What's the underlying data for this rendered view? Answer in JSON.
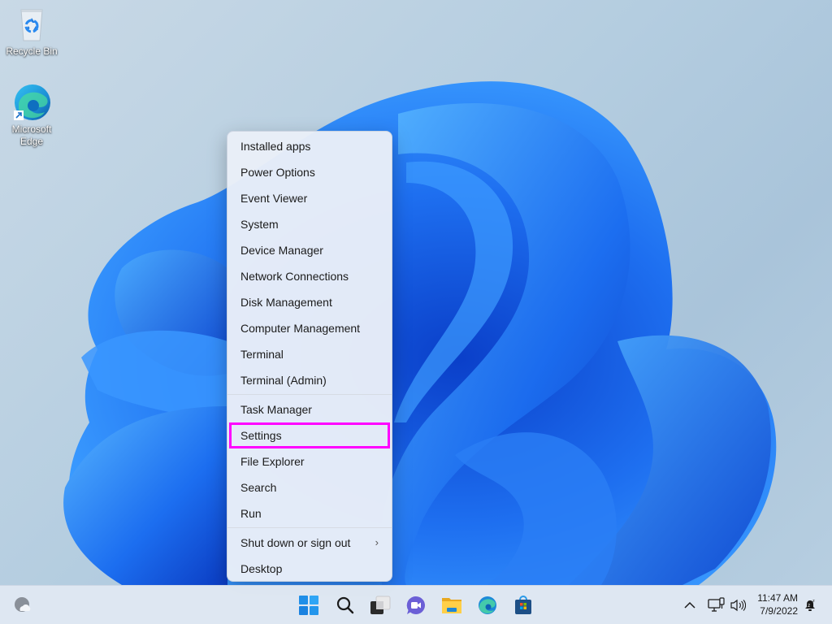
{
  "desktop": {
    "icons": [
      {
        "label": "Recycle Bin",
        "icon": "recycle-bin-icon"
      },
      {
        "label": "Microsoft Edge",
        "label_line1": "Microsoft",
        "label_line2": "Edge",
        "icon": "edge-icon",
        "shortcut": true
      }
    ]
  },
  "context_menu": {
    "groups": [
      [
        "Installed apps",
        "Power Options",
        "Event Viewer",
        "System",
        "Device Manager",
        "Network Connections",
        "Disk Management",
        "Computer Management",
        "Terminal",
        "Terminal (Admin)"
      ],
      [
        "Task Manager",
        "Settings",
        "File Explorer",
        "Search",
        "Run"
      ],
      [
        "Shut down or sign out",
        "Desktop"
      ]
    ],
    "items": {
      "installed_apps": "Installed apps",
      "power_options": "Power Options",
      "event_viewer": "Event Viewer",
      "system": "System",
      "device_manager": "Device Manager",
      "network_connections": "Network Connections",
      "disk_management": "Disk Management",
      "computer_management": "Computer Management",
      "terminal": "Terminal",
      "terminal_admin": "Terminal (Admin)",
      "task_manager": "Task Manager",
      "settings": "Settings",
      "file_explorer": "File Explorer",
      "search": "Search",
      "run": "Run",
      "shut_down": "Shut down or sign out",
      "desktop": "Desktop"
    },
    "highlighted_item": "Settings",
    "submenu_chevron": "›",
    "highlight_color": "#ff00ff"
  },
  "taskbar": {
    "widgets_icon": "weather-cloudy-moon-icon",
    "pinned": [
      {
        "name": "start",
        "icon": "windows-start-icon"
      },
      {
        "name": "search",
        "icon": "search-icon"
      },
      {
        "name": "task-view",
        "icon": "task-view-icon"
      },
      {
        "name": "chat",
        "icon": "teams-chat-icon"
      },
      {
        "name": "file-explorer",
        "icon": "folder-icon"
      },
      {
        "name": "edge",
        "icon": "edge-icon"
      },
      {
        "name": "store",
        "icon": "microsoft-store-icon"
      }
    ],
    "tray": {
      "overflow_icon": "chevron-up-icon",
      "overflow_glyph": "^",
      "network_icon": "network-ethernet-icon",
      "volume_icon": "speaker-icon",
      "time": "11:47 AM",
      "date": "7/9/2022",
      "notification_icon": "focus-assist-bell-icon"
    }
  },
  "colors": {
    "wallpaper_bloom": "#1f6fe8",
    "menu_background": "#e9eef8",
    "taskbar_background": "#e0e8f3"
  }
}
